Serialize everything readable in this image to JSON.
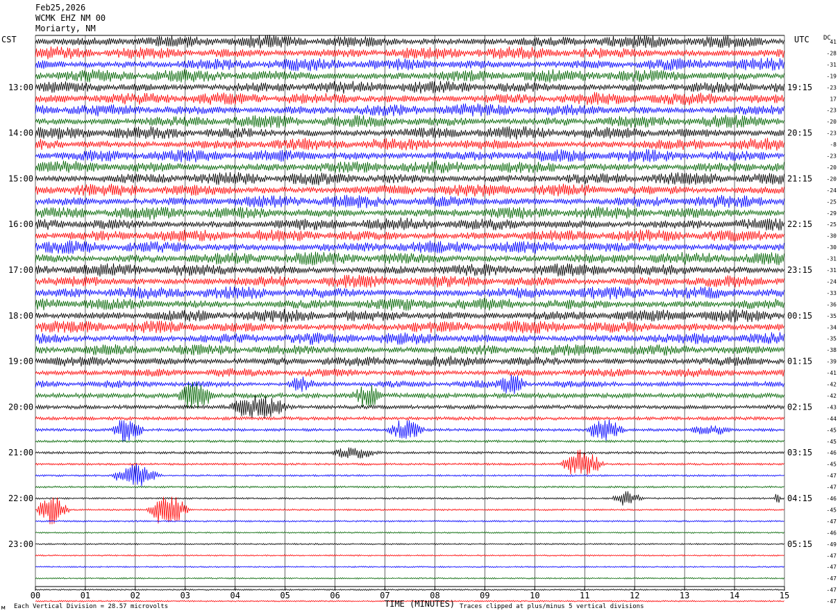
{
  "header": {
    "date": "Feb25,2026",
    "station": "WCMK EHZ NM 00",
    "location": "Moriarty, NM"
  },
  "left_timezone": "CST",
  "right_timezone": "UTC",
  "dc_label": "DC",
  "left_times": [
    "13:00",
    "14:00",
    "15:00",
    "16:00",
    "17:00",
    "18:00",
    "19:00",
    "20:00",
    "21:00",
    "22:00",
    "23:00"
  ],
  "right_times": [
    "19:15",
    "20:15",
    "21:15",
    "22:15",
    "23:15",
    "00:15",
    "01:15",
    "02:15",
    "03:15",
    "04:15",
    "05:15"
  ],
  "x_ticks": [
    "00",
    "01",
    "02",
    "03",
    "04",
    "05",
    "06",
    "07",
    "08",
    "09",
    "10",
    "11",
    "12",
    "13",
    "14",
    "15"
  ],
  "x_axis_label": "TIME (MINUTES)",
  "footer": {
    "division": "Each Vertical Division =   28.57 microvolts",
    "clipped": "Traces clipped at plus/minus 5 vertical divisions",
    "corner_mark": "м"
  },
  "colors": {
    "trace_cycle": [
      "#000000",
      "#ff0000",
      "#0000ff",
      "#006400"
    ],
    "background": "#ffffff",
    "grid": "#000000"
  },
  "chart_data": {
    "type": "helicorder",
    "x_axis": {
      "label": "TIME (MINUTES)",
      "range": [
        0,
        15
      ]
    },
    "rows_per_hour": 4,
    "row_minutes": 15,
    "dc_offsets": [
      41,
      -28,
      -31,
      -19,
      -23,
      17,
      -23,
      -20,
      -23,
      -8,
      -23,
      -20,
      -20,
      -24,
      -25,
      -29,
      -25,
      -30,
      -30,
      -31,
      -31,
      -24,
      -33,
      -36,
      -35,
      -34,
      -35,
      -38,
      -39,
      -41,
      -42,
      -42,
      -43,
      -44,
      -45,
      -45,
      -46,
      -45,
      -47,
      -47,
      -46,
      -45,
      -47,
      -46,
      -49,
      -47,
      -47,
      -47,
      -47,
      -47
    ],
    "row_activity": [
      1.0,
      1.0,
      1.0,
      1.0,
      1.0,
      1.0,
      1.0,
      1.0,
      1.0,
      1.0,
      1.0,
      1.0,
      1.0,
      1.0,
      1.0,
      1.0,
      1.0,
      1.0,
      1.0,
      1.0,
      1.0,
      1.0,
      1.0,
      1.0,
      1.0,
      1.0,
      0.95,
      0.9,
      0.85,
      0.7,
      0.6,
      0.5,
      0.4,
      0.35,
      0.3,
      0.25,
      0.25,
      0.22,
      0.2,
      0.2,
      0.18,
      0.18,
      0.18,
      0.16,
      0.16,
      0.15,
      0.15,
      0.15,
      0.15,
      0.15
    ],
    "events": [
      {
        "row": 30,
        "start_min": 5.0,
        "end_min": 6.0,
        "amp": 2.0
      },
      {
        "row": 30,
        "start_min": 9.2,
        "end_min": 10.2,
        "amp": 2.5
      },
      {
        "row": 31,
        "start_min": 2.8,
        "end_min": 4.0,
        "amp": 3.5
      },
      {
        "row": 31,
        "start_min": 6.3,
        "end_min": 7.3,
        "amp": 3.0
      },
      {
        "row": 32,
        "start_min": 3.8,
        "end_min": 5.8,
        "amp": 3.0
      },
      {
        "row": 34,
        "start_min": 1.5,
        "end_min": 2.5,
        "amp": 3.5
      },
      {
        "row": 34,
        "start_min": 7.0,
        "end_min": 8.2,
        "amp": 2.5
      },
      {
        "row": 34,
        "start_min": 11.0,
        "end_min": 12.2,
        "amp": 3.0
      },
      {
        "row": 34,
        "start_min": 13.0,
        "end_min": 14.5,
        "amp": 1.5
      },
      {
        "row": 36,
        "start_min": 5.8,
        "end_min": 7.5,
        "amp": 1.5
      },
      {
        "row": 37,
        "start_min": 10.5,
        "end_min": 11.8,
        "amp": 3.5
      },
      {
        "row": 38,
        "start_min": 1.5,
        "end_min": 3.0,
        "amp": 3.0
      },
      {
        "row": 40,
        "start_min": 11.5,
        "end_min": 12.5,
        "amp": 1.8
      },
      {
        "row": 40,
        "start_min": 14.8,
        "end_min": 15.0,
        "amp": 2.0
      },
      {
        "row": 41,
        "start_min": 0.0,
        "end_min": 1.0,
        "amp": 3.5
      },
      {
        "row": 41,
        "start_min": 2.2,
        "end_min": 3.5,
        "amp": 4.0
      }
    ]
  }
}
